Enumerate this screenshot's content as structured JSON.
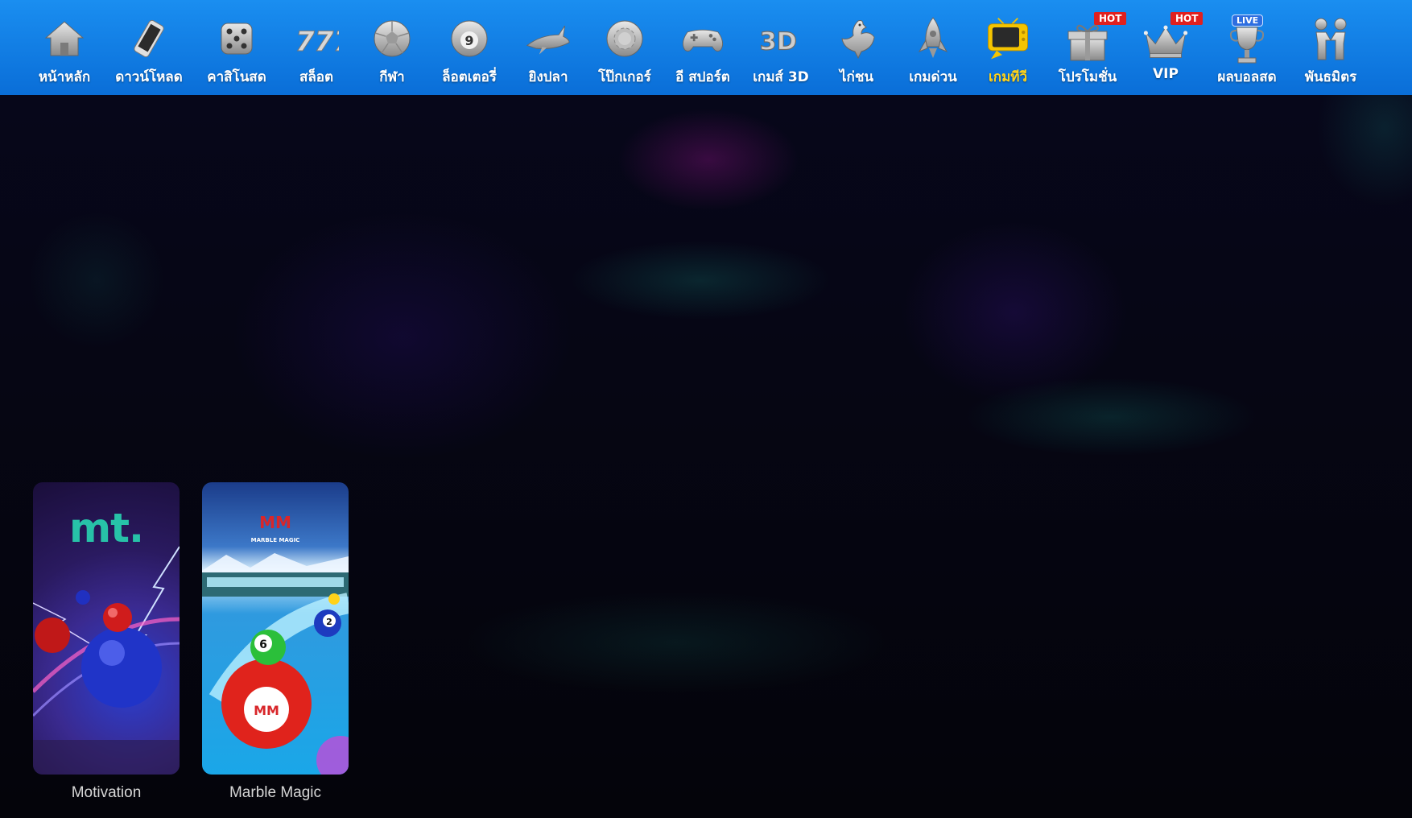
{
  "nav": {
    "items": [
      {
        "label": "หน้าหลัก",
        "icon": "home-icon"
      },
      {
        "label": "ดาวน์โหลด",
        "icon": "smartphone-icon"
      },
      {
        "label": "คาสิโนสด",
        "icon": "dice-icon"
      },
      {
        "label": "สล็อต",
        "icon": "777-icon"
      },
      {
        "label": "กีฬา",
        "icon": "soccer-ball-icon"
      },
      {
        "label": "ล็อตเตอรี่",
        "icon": "lottery-ball-icon"
      },
      {
        "label": "ยิงปลา",
        "icon": "shark-icon"
      },
      {
        "label": "โป๊กเกอร์",
        "icon": "poker-chip-icon"
      },
      {
        "label": "อี สปอร์ต",
        "icon": "gamepad-icon"
      },
      {
        "label": "เกมส์ 3D",
        "icon": "3d-icon"
      },
      {
        "label": "ไก่ชน",
        "icon": "rooster-icon"
      },
      {
        "label": "เกมด่วน",
        "icon": "rocket-icon"
      },
      {
        "label": "เกมทีวี",
        "icon": "tv-icon"
      },
      {
        "label": "โปรโมชั่น",
        "icon": "gift-icon",
        "badge": "HOT"
      },
      {
        "label": "VIP",
        "icon": "crown-icon",
        "badge": "HOT"
      },
      {
        "label": "ผลบอลสด",
        "icon": "trophy-icon",
        "badge": "LIVE"
      },
      {
        "label": "พันธมิตร",
        "icon": "partners-icon"
      }
    ],
    "active_index": 12,
    "active_color": "#ffd21a"
  },
  "games": [
    {
      "name": "Motivation",
      "logo_text": "mt."
    },
    {
      "name": "Marble Magic",
      "logo_text": "MM",
      "logo_subtext": "MARBLE MAGIC",
      "ball_numbers": [
        "6",
        "2"
      ]
    }
  ],
  "colors": {
    "nav_bg": "#1a7fe8",
    "page_bg": "#05050c",
    "hot_badge": "#e0201f"
  }
}
